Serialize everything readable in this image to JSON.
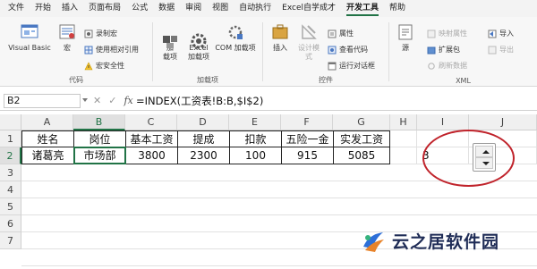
{
  "menu": {
    "items": [
      "文件",
      "开始",
      "插入",
      "页面布局",
      "公式",
      "数据",
      "审阅",
      "视图",
      "自动执行",
      "Excel自学成才",
      "开发工具",
      "帮助"
    ],
    "active": "开发工具"
  },
  "ribbon": {
    "code": {
      "visual_basic": "Visual Basic",
      "macros": "宏",
      "record_macro": "录制宏",
      "relative_ref": "使用相对引用",
      "macro_security": "宏安全性",
      "label": "代码"
    },
    "addins": {
      "addins": "加\n载项",
      "excel_addins": "Excel\n加载项",
      "com_addins": "COM 加载项",
      "label": "加载项"
    },
    "controls": {
      "insert": "插入",
      "design_mode": "设计模式",
      "properties": "属性",
      "view_code": "查看代码",
      "run_dialog": "运行对话框",
      "label": "控件"
    },
    "xml": {
      "source": "源",
      "map_properties": "映射属性",
      "expansion_packs": "扩展包",
      "refresh_data": "刷新数据",
      "import": "导入",
      "export": "导出",
      "label": "XML"
    }
  },
  "formula_bar": {
    "name_box": "B2",
    "cancel": "✕",
    "enter": "✓",
    "fx": "fx",
    "formula": "=INDEX(工资表!B:B,$I$2)"
  },
  "grid": {
    "columns": [
      "A",
      "B",
      "C",
      "D",
      "E",
      "F",
      "G",
      "H",
      "I",
      "J"
    ],
    "rows": [
      "1",
      "2",
      "3",
      "4",
      "5",
      "6",
      "7"
    ],
    "header_row": [
      "姓名",
      "岗位",
      "基本工资",
      "提成",
      "扣款",
      "五险一金",
      "实发工资"
    ],
    "data_row": [
      "诸葛亮",
      "市场部",
      "3800",
      "2300",
      "100",
      "915",
      "5085"
    ],
    "i2_value": "3",
    "active_cell": "B2"
  },
  "watermark": {
    "text": "云之居软件园"
  },
  "colors": {
    "accent": "#217346",
    "highlight_circle": "#c0232b"
  }
}
